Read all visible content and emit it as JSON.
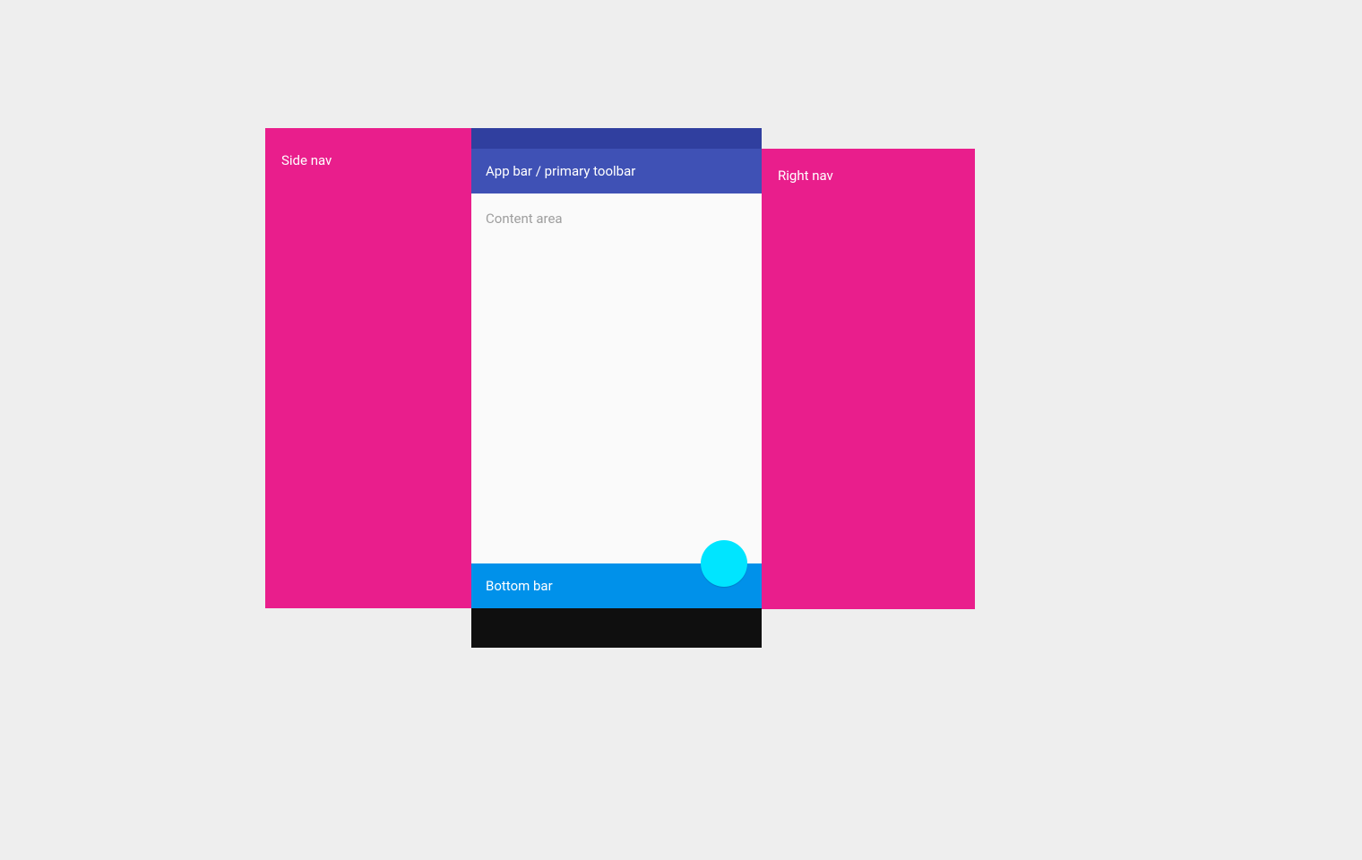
{
  "side_nav": {
    "label": "Side nav"
  },
  "right_nav": {
    "label": "Right nav"
  },
  "app_bar": {
    "label": "App bar / primary toolbar"
  },
  "content": {
    "label": "Content area"
  },
  "bottom_bar": {
    "label": "Bottom bar"
  },
  "colors": {
    "side_nav": "#e91e8c",
    "right_nav": "#e91e8c",
    "status_bar": "#303f9f",
    "app_bar": "#3f51b5",
    "content_bg": "#fafafa",
    "content_text": "#9e9e9e",
    "bottom_bar": "#0091ea",
    "nav_bar": "#0f0f0f",
    "fab": "#00e5ff",
    "canvas_bg": "#eeeeee"
  }
}
